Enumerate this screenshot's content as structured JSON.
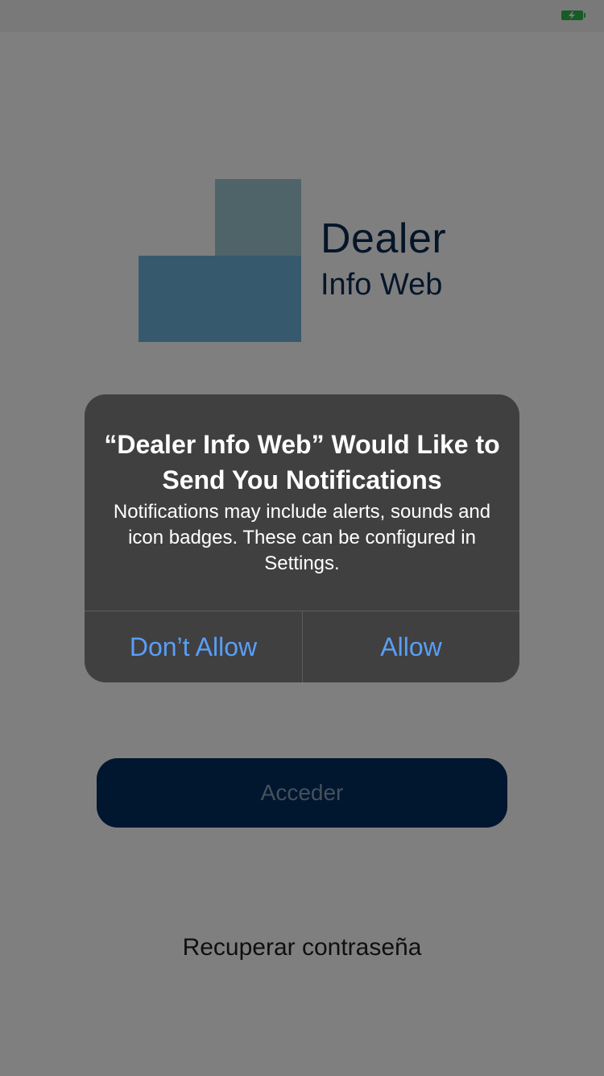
{
  "status_bar": {
    "battery_icon": "battery-charging-icon",
    "battery_color": "#2fb84a"
  },
  "logo": {
    "line1": "Dealer",
    "line2": "Info Web",
    "colors": {
      "square_top": "#9ec9d3",
      "square_bottom": "#6fb2dd",
      "text": "#0b2a52"
    }
  },
  "login": {
    "access_button_label": "Acceder",
    "recover_link_label": "Recuperar contraseña"
  },
  "alert": {
    "title": "“Dealer Info Web” Would Like to Send You Notifications",
    "message": "Notifications may include alerts, sounds and icon badges. These can be configured in Settings.",
    "dont_allow_label": "Don’t Allow",
    "allow_label": "Allow",
    "button_color": "#5a9ef7"
  }
}
